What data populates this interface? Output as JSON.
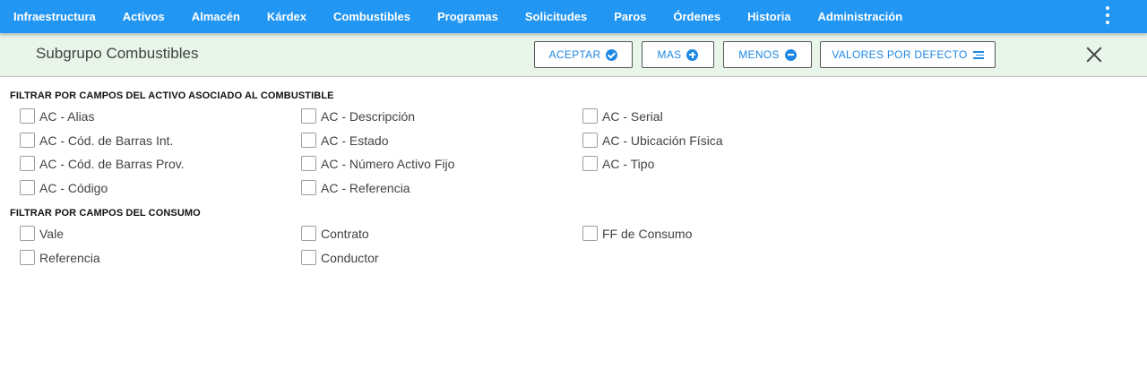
{
  "nav": {
    "items": [
      "Infraestructura",
      "Activos",
      "Almacén",
      "Kárdex",
      "Combustibles",
      "Programas",
      "Solicitudes",
      "Paros",
      "Órdenes",
      "Historia",
      "Administración"
    ],
    "menu_icon": "more-vert-icon"
  },
  "header": {
    "title": "Subgrupo Combustibles",
    "buttons": {
      "accept": "ACEPTAR",
      "more": "MAS",
      "less": "MENOS",
      "defaults": "VALORES POR DEFECTO"
    },
    "close_icon": "close-icon"
  },
  "sections": {
    "asset": {
      "title": "FILTRAR POR CAMPOS DEL ACTIVO ASOCIADO AL COMBUSTIBLE",
      "options": [
        {
          "label": "AC - Alias",
          "checked": false
        },
        {
          "label": "AC - Cód. de Barras Int.",
          "checked": false
        },
        {
          "label": "AC - Cód. de Barras Prov.",
          "checked": false
        },
        {
          "label": "AC - Código",
          "checked": false
        },
        {
          "label": "AC - Descripción",
          "checked": false
        },
        {
          "label": "AC - Estado",
          "checked": false
        },
        {
          "label": "AC - Número Activo Fijo",
          "checked": false
        },
        {
          "label": "AC - Referencia",
          "checked": false
        },
        {
          "label": "AC - Serial",
          "checked": false
        },
        {
          "label": "AC - Ubicación Física",
          "checked": false
        },
        {
          "label": "AC - Tipo",
          "checked": false
        }
      ]
    },
    "consumption": {
      "title": "FILTRAR POR CAMPOS DEL CONSUMO",
      "options": [
        {
          "label": "Vale",
          "checked": false
        },
        {
          "label": "Referencia",
          "checked": false
        },
        {
          "label": "Contrato",
          "checked": false
        },
        {
          "label": "Conductor",
          "checked": false
        },
        {
          "label": "FF de Consumo",
          "checked": false
        }
      ]
    }
  },
  "colors": {
    "navbar": "#2196f3",
    "header_bg": "#e8f5e9",
    "button_text": "#1e88e5"
  }
}
